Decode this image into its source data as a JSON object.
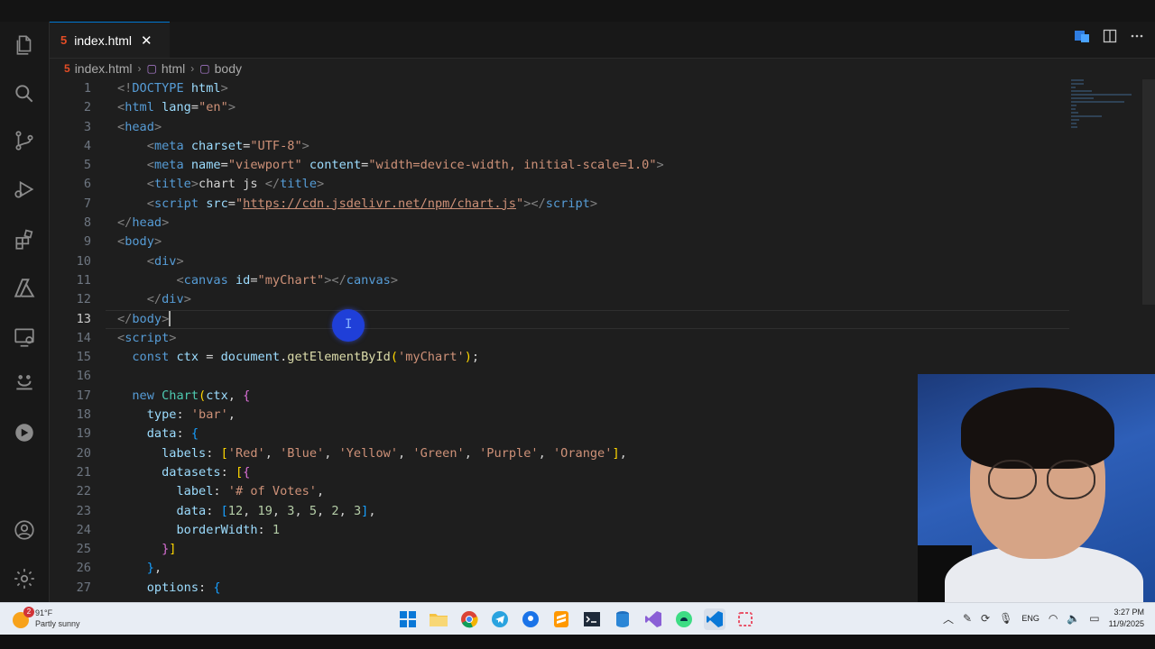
{
  "editor": {
    "tab_label": "index.html",
    "file_icon": "5",
    "close_glyph": "✕",
    "breadcrumb": [
      "index.html",
      "html",
      "body"
    ]
  },
  "code_lines": [
    {
      "n": "1",
      "tokens": [
        [
          "punct",
          "<!"
        ],
        [
          "tag",
          "DOCTYPE"
        ],
        [
          "text",
          " "
        ],
        [
          "attr",
          "html"
        ],
        [
          "punct",
          ">"
        ]
      ]
    },
    {
      "n": "2",
      "tokens": [
        [
          "punct",
          "<"
        ],
        [
          "tag",
          "html"
        ],
        [
          "text",
          " "
        ],
        [
          "attr",
          "lang"
        ],
        [
          "text",
          "="
        ],
        [
          "str",
          "\"en\""
        ],
        [
          "punct",
          ">"
        ]
      ]
    },
    {
      "n": "3",
      "tokens": [
        [
          "punct",
          "<"
        ],
        [
          "tag",
          "head"
        ],
        [
          "punct",
          ">"
        ]
      ]
    },
    {
      "n": "4",
      "tokens": [
        [
          "text",
          "    "
        ],
        [
          "punct",
          "<"
        ],
        [
          "tag",
          "meta"
        ],
        [
          "text",
          " "
        ],
        [
          "attr",
          "charset"
        ],
        [
          "text",
          "="
        ],
        [
          "str",
          "\"UTF-8\""
        ],
        [
          "punct",
          ">"
        ]
      ]
    },
    {
      "n": "5",
      "tokens": [
        [
          "text",
          "    "
        ],
        [
          "punct",
          "<"
        ],
        [
          "tag",
          "meta"
        ],
        [
          "text",
          " "
        ],
        [
          "attr",
          "name"
        ],
        [
          "text",
          "="
        ],
        [
          "str",
          "\"viewport\""
        ],
        [
          "text",
          " "
        ],
        [
          "attr",
          "content"
        ],
        [
          "text",
          "="
        ],
        [
          "str",
          "\"width=device-width, initial-scale=1.0\""
        ],
        [
          "punct",
          ">"
        ]
      ]
    },
    {
      "n": "6",
      "tokens": [
        [
          "text",
          "    "
        ],
        [
          "punct",
          "<"
        ],
        [
          "tag",
          "title"
        ],
        [
          "punct",
          ">"
        ],
        [
          "text",
          "chart js "
        ],
        [
          "punct",
          "</"
        ],
        [
          "tag",
          "title"
        ],
        [
          "punct",
          ">"
        ]
      ]
    },
    {
      "n": "7",
      "tokens": [
        [
          "text",
          "    "
        ],
        [
          "punct",
          "<"
        ],
        [
          "tag",
          "script"
        ],
        [
          "text",
          " "
        ],
        [
          "attr",
          "src"
        ],
        [
          "text",
          "="
        ],
        [
          "str",
          "\""
        ],
        [
          "link",
          "https://cdn.jsdelivr.net/npm/chart.js"
        ],
        [
          "str",
          "\""
        ],
        [
          "punct",
          "></"
        ],
        [
          "tag",
          "script"
        ],
        [
          "punct",
          ">"
        ]
      ]
    },
    {
      "n": "8",
      "tokens": [
        [
          "punct",
          "</"
        ],
        [
          "tag",
          "head"
        ],
        [
          "punct",
          ">"
        ]
      ]
    },
    {
      "n": "9",
      "tokens": [
        [
          "punct",
          "<"
        ],
        [
          "tag",
          "body"
        ],
        [
          "punct",
          ">"
        ]
      ]
    },
    {
      "n": "10",
      "tokens": [
        [
          "text",
          "    "
        ],
        [
          "punct",
          "<"
        ],
        [
          "tag",
          "div"
        ],
        [
          "punct",
          ">"
        ]
      ]
    },
    {
      "n": "11",
      "tokens": [
        [
          "text",
          "        "
        ],
        [
          "punct",
          "<"
        ],
        [
          "tag",
          "canvas"
        ],
        [
          "text",
          " "
        ],
        [
          "attr",
          "id"
        ],
        [
          "text",
          "="
        ],
        [
          "str",
          "\"myChart\""
        ],
        [
          "punct",
          "></"
        ],
        [
          "tag",
          "canvas"
        ],
        [
          "punct",
          ">"
        ]
      ]
    },
    {
      "n": "12",
      "tokens": [
        [
          "text",
          "    "
        ],
        [
          "punct",
          "</"
        ],
        [
          "tag",
          "div"
        ],
        [
          "punct",
          ">"
        ]
      ]
    },
    {
      "n": "13",
      "tokens": [
        [
          "punct",
          "</"
        ],
        [
          "tag",
          "body"
        ],
        [
          "punct",
          ">"
        ]
      ],
      "current": true
    },
    {
      "n": "14",
      "tokens": [
        [
          "punct",
          "<"
        ],
        [
          "tag",
          "script"
        ],
        [
          "punct",
          ">"
        ]
      ]
    },
    {
      "n": "15",
      "tokens": [
        [
          "text",
          "  "
        ],
        [
          "kw",
          "const"
        ],
        [
          "text",
          " "
        ],
        [
          "var",
          "ctx"
        ],
        [
          "text",
          " = "
        ],
        [
          "var",
          "document"
        ],
        [
          "text",
          "."
        ],
        [
          "fn",
          "getElementById"
        ],
        [
          "brk1",
          "("
        ],
        [
          "str",
          "'myChart'"
        ],
        [
          "brk1",
          ")"
        ],
        [
          "text",
          ";"
        ]
      ]
    },
    {
      "n": "16",
      "tokens": []
    },
    {
      "n": "17",
      "tokens": [
        [
          "text",
          "  "
        ],
        [
          "kw",
          "new"
        ],
        [
          "text",
          " "
        ],
        [
          "cls",
          "Chart"
        ],
        [
          "brk1",
          "("
        ],
        [
          "var",
          "ctx"
        ],
        [
          "text",
          ", "
        ],
        [
          "brk2",
          "{"
        ]
      ]
    },
    {
      "n": "18",
      "tokens": [
        [
          "text",
          "    "
        ],
        [
          "var",
          "type"
        ],
        [
          "text",
          ": "
        ],
        [
          "str",
          "'bar'"
        ],
        [
          "text",
          ","
        ]
      ]
    },
    {
      "n": "19",
      "tokens": [
        [
          "text",
          "    "
        ],
        [
          "var",
          "data"
        ],
        [
          "text",
          ": "
        ],
        [
          "brk3",
          "{"
        ]
      ]
    },
    {
      "n": "20",
      "tokens": [
        [
          "text",
          "      "
        ],
        [
          "var",
          "labels"
        ],
        [
          "text",
          ": "
        ],
        [
          "brk1",
          "["
        ],
        [
          "str",
          "'Red'"
        ],
        [
          "text",
          ", "
        ],
        [
          "str",
          "'Blue'"
        ],
        [
          "text",
          ", "
        ],
        [
          "str",
          "'Yellow'"
        ],
        [
          "text",
          ", "
        ],
        [
          "str",
          "'Green'"
        ],
        [
          "text",
          ", "
        ],
        [
          "str",
          "'Purple'"
        ],
        [
          "text",
          ", "
        ],
        [
          "str",
          "'Orange'"
        ],
        [
          "brk1",
          "]"
        ],
        [
          "text",
          ","
        ]
      ]
    },
    {
      "n": "21",
      "tokens": [
        [
          "text",
          "      "
        ],
        [
          "var",
          "datasets"
        ],
        [
          "text",
          ": "
        ],
        [
          "brk1",
          "["
        ],
        [
          "brk2",
          "{"
        ]
      ]
    },
    {
      "n": "22",
      "tokens": [
        [
          "text",
          "        "
        ],
        [
          "var",
          "label"
        ],
        [
          "text",
          ": "
        ],
        [
          "str",
          "'# of Votes'"
        ],
        [
          "text",
          ","
        ]
      ]
    },
    {
      "n": "23",
      "tokens": [
        [
          "text",
          "        "
        ],
        [
          "var",
          "data"
        ],
        [
          "text",
          ": "
        ],
        [
          "brk3",
          "["
        ],
        [
          "num",
          "12"
        ],
        [
          "text",
          ", "
        ],
        [
          "num",
          "19"
        ],
        [
          "text",
          ", "
        ],
        [
          "num",
          "3"
        ],
        [
          "text",
          ", "
        ],
        [
          "num",
          "5"
        ],
        [
          "text",
          ", "
        ],
        [
          "num",
          "2"
        ],
        [
          "text",
          ", "
        ],
        [
          "num",
          "3"
        ],
        [
          "brk3",
          "]"
        ],
        [
          "text",
          ","
        ]
      ]
    },
    {
      "n": "24",
      "tokens": [
        [
          "text",
          "        "
        ],
        [
          "var",
          "borderWidth"
        ],
        [
          "text",
          ": "
        ],
        [
          "num",
          "1"
        ]
      ]
    },
    {
      "n": "25",
      "tokens": [
        [
          "text",
          "      "
        ],
        [
          "brk2",
          "}"
        ],
        [
          "brk1",
          "]"
        ]
      ]
    },
    {
      "n": "26",
      "tokens": [
        [
          "text",
          "    "
        ],
        [
          "brk3",
          "}"
        ],
        [
          "text",
          ","
        ]
      ]
    },
    {
      "n": "27",
      "tokens": [
        [
          "text",
          "    "
        ],
        [
          "var",
          "options"
        ],
        [
          "text",
          ": "
        ],
        [
          "brk3",
          "{"
        ]
      ]
    }
  ],
  "taskbar": {
    "weather_temp": "91°F",
    "weather_desc": "Partly sunny",
    "weather_badge": "2",
    "language": "ENG",
    "time": "3:27 PM",
    "date": "11/9/2025"
  },
  "colors": {
    "accent": "#0078d4",
    "html_icon": "#e44d26",
    "editor_bg": "#1e1e1e"
  }
}
